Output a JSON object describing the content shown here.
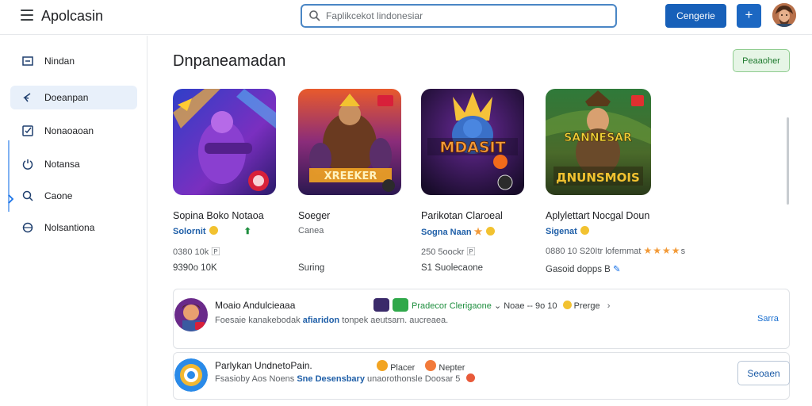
{
  "app": {
    "title": "Apolcasin"
  },
  "search": {
    "placeholder": "Faplikcekot lindonesiar"
  },
  "header": {
    "primary_button": "Cengerie",
    "plus_label": "+"
  },
  "sidebar": {
    "items": [
      {
        "label": "Nindan",
        "icon": "grid-icon"
      },
      {
        "label": "Doeanpan",
        "icon": "pointer-icon"
      },
      {
        "label": "Nonaoaoan",
        "icon": "checkbox-icon"
      },
      {
        "label": "Notansa",
        "icon": "power-icon"
      },
      {
        "label": "Caone",
        "icon": "search-icon"
      },
      {
        "label": "Nolsantiona",
        "icon": "globe-icon"
      }
    ]
  },
  "main": {
    "title": "Dnpaneamadan",
    "chip_button": "Peaaoher",
    "cards": [
      {
        "name": "Sopina Boko Notaoa",
        "dev": "Solornit",
        "meta": "0380 10k",
        "sub": "9390o 10K",
        "art_text": ""
      },
      {
        "name": "Soeger",
        "dev": "Canea",
        "meta": "",
        "sub": "Suring",
        "art_text": "XREEKER"
      },
      {
        "name": "Parikotan Claroeal",
        "dev": "Sogna Naan",
        "meta": "250 5oockr",
        "sub": "S1 Suolecaone",
        "art_text": "MDASIT"
      },
      {
        "name": "Aplylettart Nocgal Doun",
        "dev": "Sigenat",
        "meta": "0880 10 S20Itr lofemmat",
        "sub": "Gasoid dopps",
        "art_text": "SANNESAR",
        "rating_stars": "★★★★"
      }
    ],
    "rows": [
      {
        "title": "Moaio Andulcieaaa",
        "desc_plain": "Foesaie kanakebodak",
        "desc_link": "afiaridon",
        "desc_rest": "tonpek aeutsarn. aucreaea.",
        "tag_green": "Pradecor Clerigaone",
        "tag_rest": "Noae -- 9o 10",
        "tag_end": "Prerge",
        "action": "Sarra"
      },
      {
        "title": "Parlykan UndnetoPain.",
        "desc_plain": "Fsasioby Aos Noens",
        "desc_link": "Sne Desensbary",
        "desc_rest": "unaorothonsle Doosar 5",
        "tag_a": "Placer",
        "tag_b": "Nepter",
        "action": "Seoaen"
      }
    ]
  },
  "colors": {
    "primary": "#1760b9",
    "accent_green": "#1e8e3e",
    "link": "#1f5fa8"
  }
}
